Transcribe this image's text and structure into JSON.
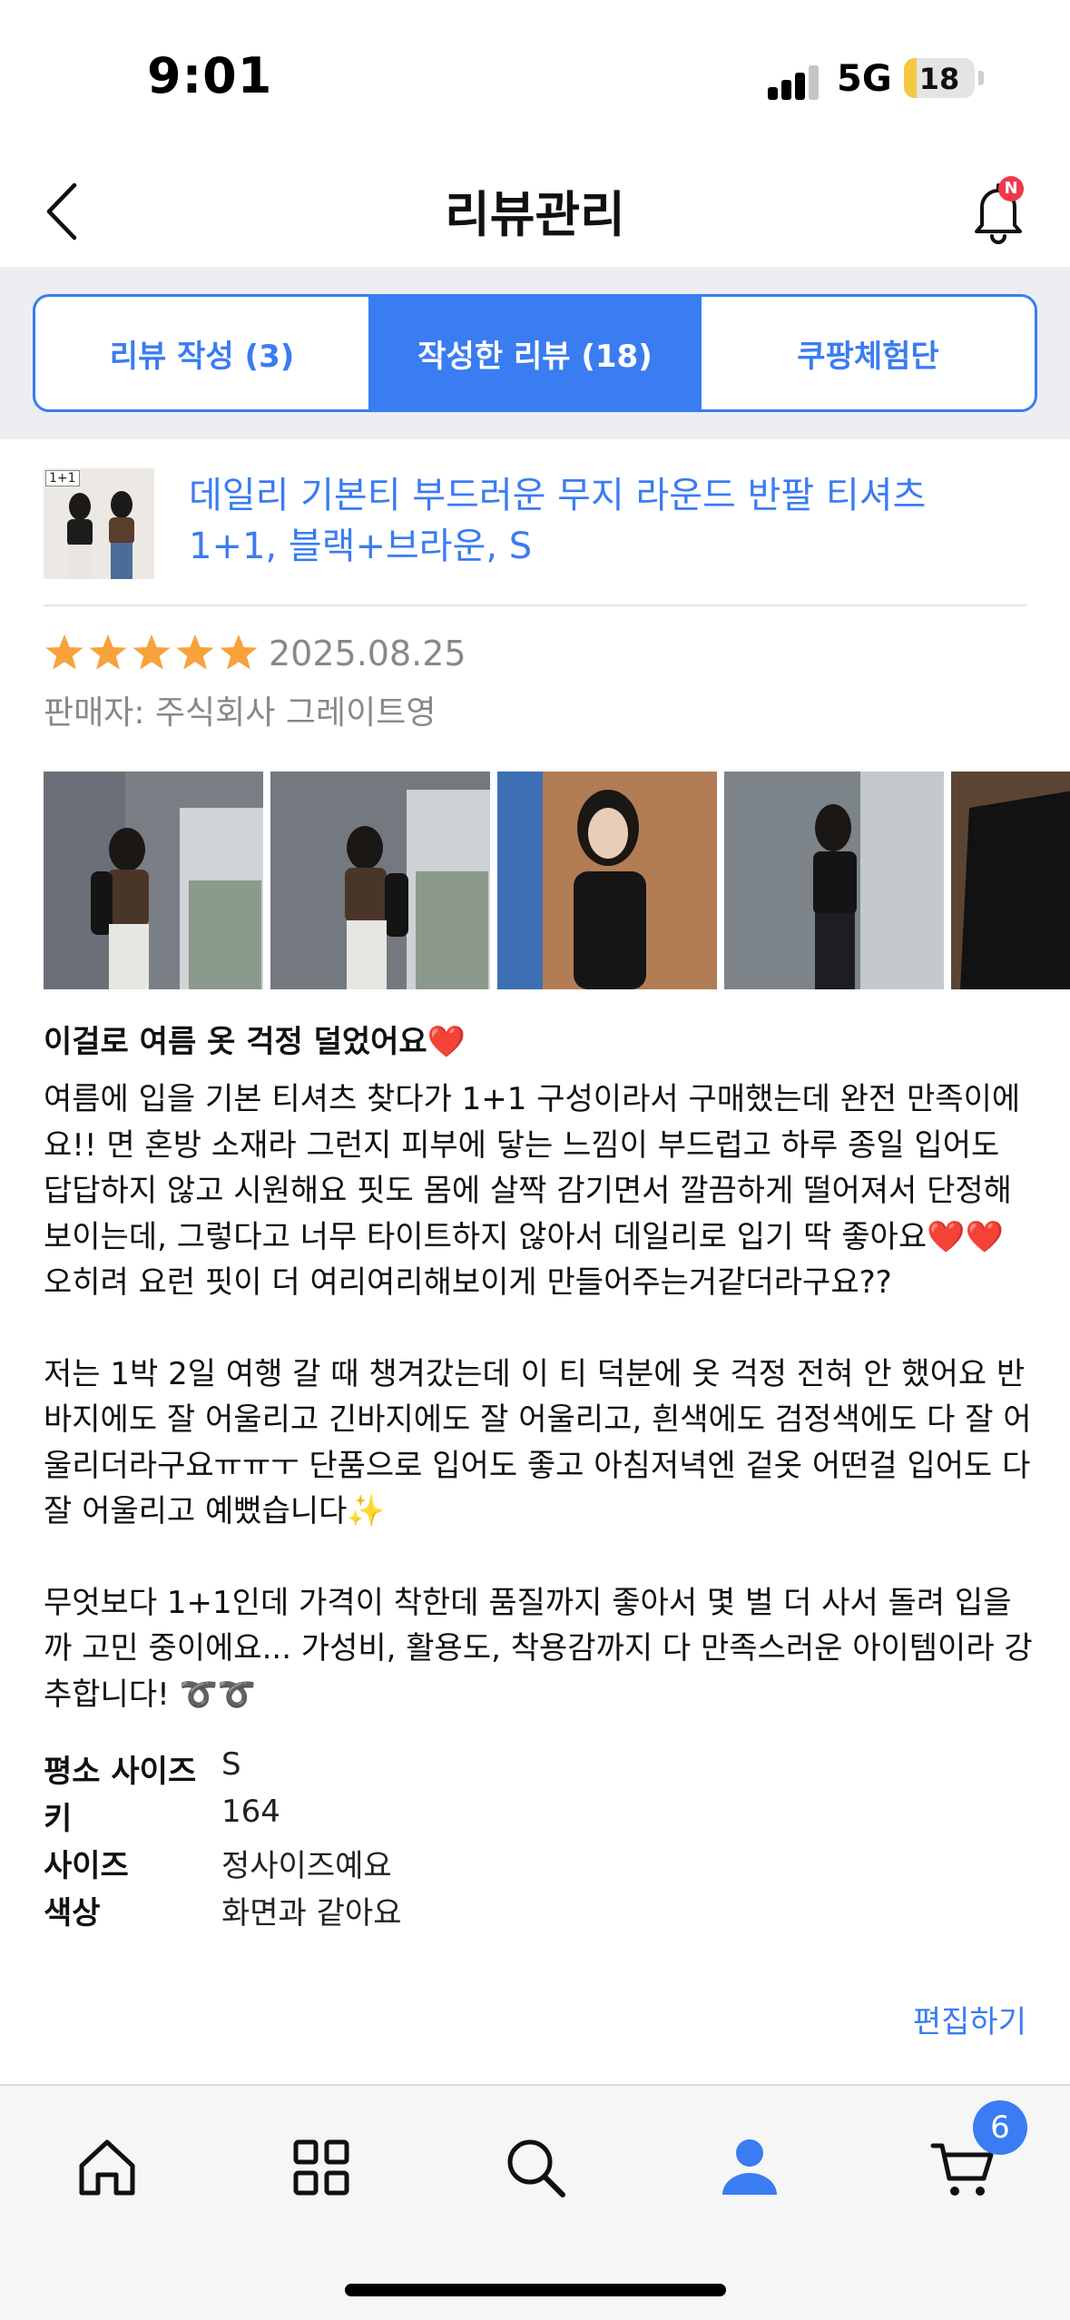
{
  "status_bar": {
    "time": "9:01",
    "network": "5G",
    "battery": "18",
    "battery_level": 0.18
  },
  "header": {
    "title": "리뷰관리",
    "notification_badge": "N"
  },
  "tabs": [
    {
      "label": "리뷰 작성 (3)",
      "active": false
    },
    {
      "label": "작성한 리뷰 (18)",
      "active": true
    },
    {
      "label": "쿠팡체험단",
      "active": false
    }
  ],
  "review": {
    "product_thumb_tag": "1+1",
    "product_title": "데일리 기본티 부드러운 무지 라운드 반팔 티셔츠 1+1, 블랙+브라운, S",
    "rating": 5,
    "date": "2025.08.25",
    "seller": "판매자: 주식회사 그레이트영",
    "photo_count_visible": 5,
    "headline": "이걸로 여름 옷 걱정 덜었어요❤️",
    "paragraphs": [
      "여름에 입을 기본 티셔츠 찾다가 1+1 구성이라서 구매했는데 완전 만족이에요!! 면 혼방 소재라 그런지 피부에 닿는 느낌이 부드럽고 하루 종일 입어도 답답하지 않고 시원해요 핏도 몸에 살짝 감기면서 깔끔하게 떨어져서 단정해 보이는데, 그렇다고 너무 타이트하지 않아서 데일리로 입기 딱 좋아요❤️❤️ 오히려 요런 핏이 더 여리여리해보이게 만들어주는거같더라구요??",
      "저는 1박 2일 여행 갈 때 챙겨갔는데 이 티 덕분에 옷 걱정 전혀 안 했어요 반바지에도 잘 어울리고 긴바지에도 잘 어울리고, 흰색에도 검정색에도 다 잘 어울리더라구요ㅠㅠㅜ 단품으로 입어도 좋고 아침저녁엔 겉옷 어떤걸 입어도 다 잘 어울리고 예뻤습니다✨",
      "무엇보다 1+1인데 가격이 착한데 품질까지 좋아서 몇 벌 더 사서 돌려 입을까 고민 중이에요... 가성비, 활용도, 착용감까지 다 만족스러운 아이템이라 강추합니다! ➰➰"
    ],
    "specs": [
      {
        "key": "평소 사이즈",
        "value": "S"
      },
      {
        "key": "키",
        "value": "164"
      },
      {
        "key": "사이즈",
        "value": "정사이즈예요"
      },
      {
        "key": "색상",
        "value": "화면과 같아요"
      }
    ],
    "edit_label": "편집하기"
  },
  "bottom_nav": {
    "items": [
      "home-icon",
      "grid-icon",
      "search-icon",
      "profile-icon",
      "cart-icon"
    ],
    "active": "profile-icon",
    "cart_count": "6"
  },
  "colors": {
    "accent": "#3a7cf1",
    "star": "#f7a23a",
    "muted": "#888888",
    "badge": "#f0374c"
  }
}
